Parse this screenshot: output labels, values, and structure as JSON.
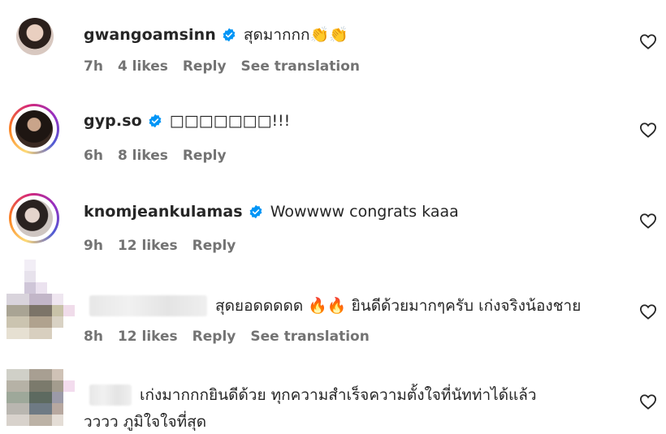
{
  "comments": [
    {
      "username": "gwangoamsinn",
      "text": "สุดมากกก👏👏",
      "time": "7h",
      "likes": "4 likes",
      "reply": "Reply",
      "translation": "See translation"
    },
    {
      "username": "gyp.so",
      "text": "□□□□□□□!!!",
      "time": "6h",
      "likes": "8 likes",
      "reply": "Reply"
    },
    {
      "username": "knomjeankulamas",
      "text": "Wowwww congrats kaaa",
      "time": "9h",
      "likes": "12 likes",
      "reply": "Reply"
    },
    {
      "text": "สุดยอดดดดด 🔥🔥 ยินดีด้วยมากๆครับ เก่งจริงน้องชาย",
      "time": "8h",
      "likes": "12 likes",
      "reply": "Reply",
      "translation": "See translation"
    },
    {
      "text_line1": "เก่งมากกกยินดีด้วย ทุกความสำเร็จความตั้งใจที่นัทท่าได้แล้ว",
      "text_line2": "วววว ภูมิใจใจที่สุด"
    }
  ],
  "colors": {
    "verified": "#0095f6",
    "meta": "#737373",
    "text": "#262626"
  },
  "icons": {
    "like": "heart-outline-icon",
    "verified": "verified-badge-icon"
  }
}
